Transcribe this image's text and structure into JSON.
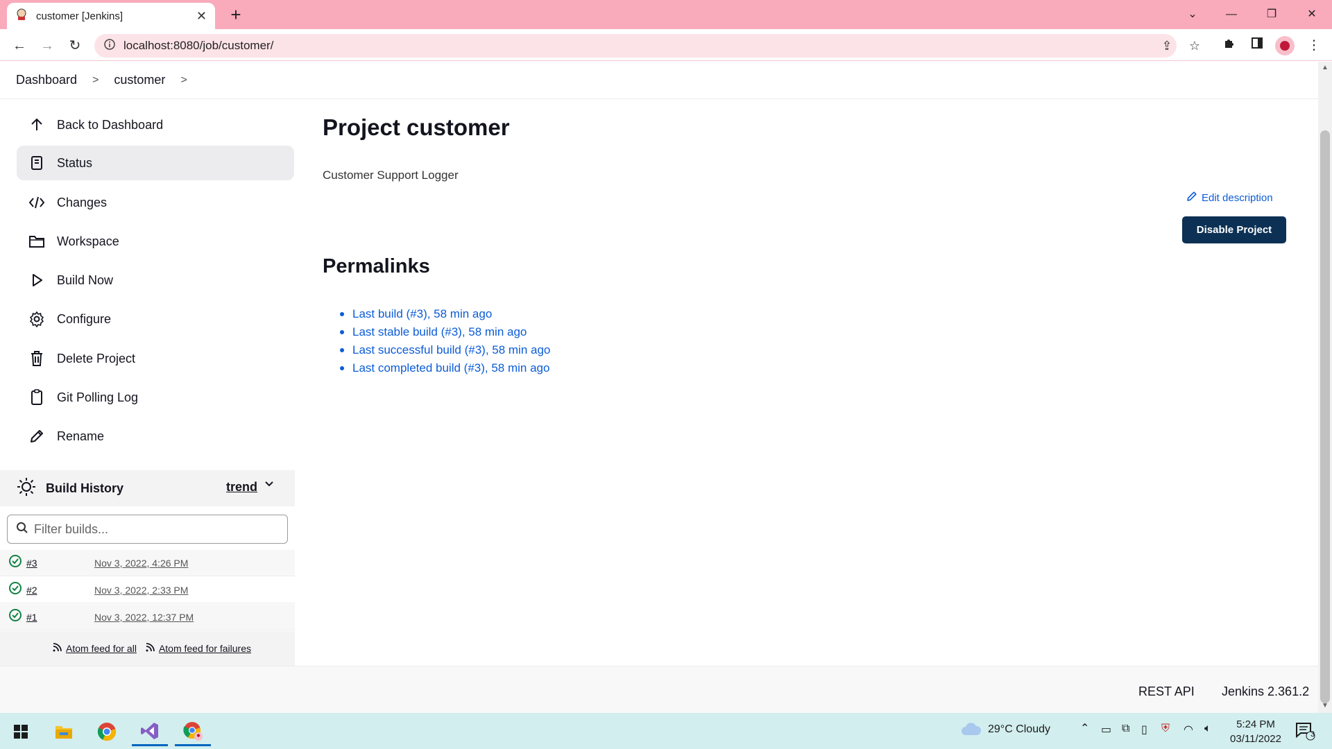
{
  "browser": {
    "tab_title": "customer [Jenkins]",
    "url": "localhost:8080/job/customer/"
  },
  "breadcrumb": [
    "Dashboard",
    "customer"
  ],
  "sidebar": {
    "items": [
      {
        "label": "Back to Dashboard",
        "icon": "arrow-up-icon",
        "active": false
      },
      {
        "label": "Status",
        "icon": "document-icon",
        "active": true
      },
      {
        "label": "Changes",
        "icon": "code-icon",
        "active": false
      },
      {
        "label": "Workspace",
        "icon": "folder-icon",
        "active": false
      },
      {
        "label": "Build Now",
        "icon": "play-icon",
        "active": false
      },
      {
        "label": "Configure",
        "icon": "gear-icon",
        "active": false
      },
      {
        "label": "Delete Project",
        "icon": "trash-icon",
        "active": false
      },
      {
        "label": "Git Polling Log",
        "icon": "clipboard-icon",
        "active": false
      },
      {
        "label": "Rename",
        "icon": "pencil-icon",
        "active": false
      }
    ]
  },
  "build_history": {
    "title": "Build History",
    "trend_label": "trend",
    "filter_placeholder": "Filter builds...",
    "builds": [
      {
        "number": "#3",
        "date": "Nov 3, 2022, 4:26 PM",
        "status": "success"
      },
      {
        "number": "#2",
        "date": "Nov 3, 2022, 2:33 PM",
        "status": "success"
      },
      {
        "number": "#1",
        "date": "Nov 3, 2022, 12:37 PM",
        "status": "success"
      }
    ],
    "feed_all": "Atom feed for all",
    "feed_failures": "Atom feed for failures"
  },
  "main": {
    "title": "Project customer",
    "description": "Customer Support Logger",
    "edit_description": "Edit description",
    "disable_button": "Disable Project",
    "permalinks_title": "Permalinks",
    "permalinks": [
      "Last build (#3), 58 min ago",
      "Last stable build (#3), 58 min ago",
      "Last successful build (#3), 58 min ago",
      "Last completed build (#3), 58 min ago"
    ]
  },
  "footer": {
    "rest_api": "REST API",
    "version": "Jenkins 2.361.2"
  },
  "taskbar": {
    "weather": "29°C  Cloudy",
    "time": "5:24 PM",
    "date": "03/11/2022",
    "notifications": "3"
  },
  "colors": {
    "tabstrip": "#f9aabb",
    "link": "#0b5cd7",
    "primary_button": "#0c3154",
    "success": "#138347"
  }
}
